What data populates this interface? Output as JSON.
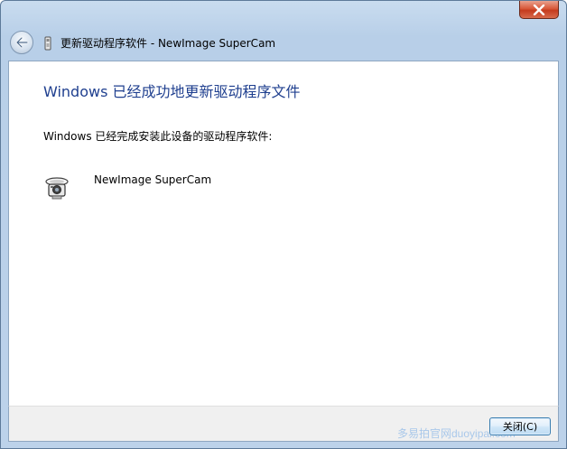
{
  "window": {
    "title": "更新驱动程序软件 - NewImage SuperCam",
    "close_label": "×"
  },
  "content": {
    "heading": "Windows 已经成功地更新驱动程序文件",
    "description": "Windows 已经完成安装此设备的驱动程序软件:",
    "device_name": "NewImage SuperCam"
  },
  "footer": {
    "close_button_label": "关闭(C)",
    "watermark": "多易拍官网duoyipai.com"
  },
  "colors": {
    "heading": "#1f3f8f",
    "close_btn": "#c43b1e",
    "chrome": "#bcd2ea"
  },
  "icons": {
    "back": "back-arrow-icon",
    "device_manager": "device-icon",
    "webcam": "webcam-icon",
    "close": "close-icon"
  }
}
